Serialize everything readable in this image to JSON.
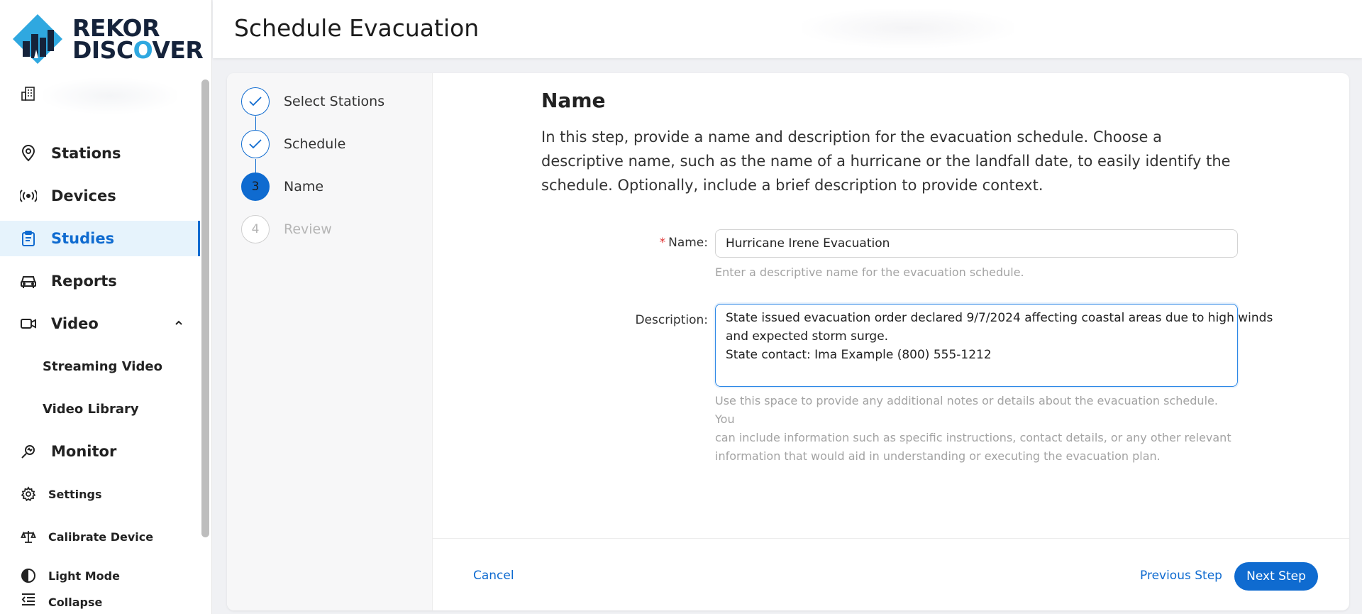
{
  "brand": {
    "line1": "REKOR",
    "line2_a": "DISC",
    "line2_b": "O",
    "line2_c": "VER"
  },
  "header": {
    "title": "Schedule Evacuation"
  },
  "sidebar": {
    "items": [
      {
        "label": "Stations"
      },
      {
        "label": "Devices"
      },
      {
        "label": "Studies"
      },
      {
        "label": "Reports"
      },
      {
        "label": "Video"
      },
      {
        "label": "Streaming Video"
      },
      {
        "label": "Video Library"
      },
      {
        "label": "Monitor"
      },
      {
        "label": "Settings"
      },
      {
        "label": "Calibrate Device"
      },
      {
        "label": "Light Mode"
      },
      {
        "label": "Collapse"
      }
    ]
  },
  "steps": [
    {
      "label": "Select Stations",
      "marker": ""
    },
    {
      "label": "Schedule",
      "marker": ""
    },
    {
      "label": "Name",
      "marker": "3"
    },
    {
      "label": "Review",
      "marker": "4"
    }
  ],
  "content": {
    "heading": "Name",
    "intro": "In this step, provide a name and description for the evacuation schedule. Choose a descriptive name, such as the name of a hurricane or the landfall date, to easily identify the schedule. Optionally, include a brief description to provide context."
  },
  "form": {
    "name_label": "Name",
    "name_colon": ":",
    "required_mark": "*",
    "name_value": "Hurricane Irene Evacuation",
    "name_help": "Enter a descriptive name for the evacuation schedule.",
    "description_label": "Description",
    "description_colon": ":",
    "description_lines": [
      "State issued evacuation order declared 9/7/2024 affecting coastal areas due to high winds",
      "and expected storm surge.",
      "State contact: Ima Example (800) 555-1212"
    ],
    "description_help_lines": [
      "Use this space to provide any additional notes or details about the evacuation schedule. You",
      "can include information such as specific instructions, contact details, or any other relevant",
      "information that would aid in understanding or executing the evacuation plan."
    ]
  },
  "footer": {
    "cancel": "Cancel",
    "previous": "Previous Step",
    "next": "Next Step"
  },
  "colors": {
    "accent": "#0f6bd0",
    "active_bg": "#e6f3fc",
    "logo_accent": "#2fa8e0",
    "required": "#e03131"
  }
}
